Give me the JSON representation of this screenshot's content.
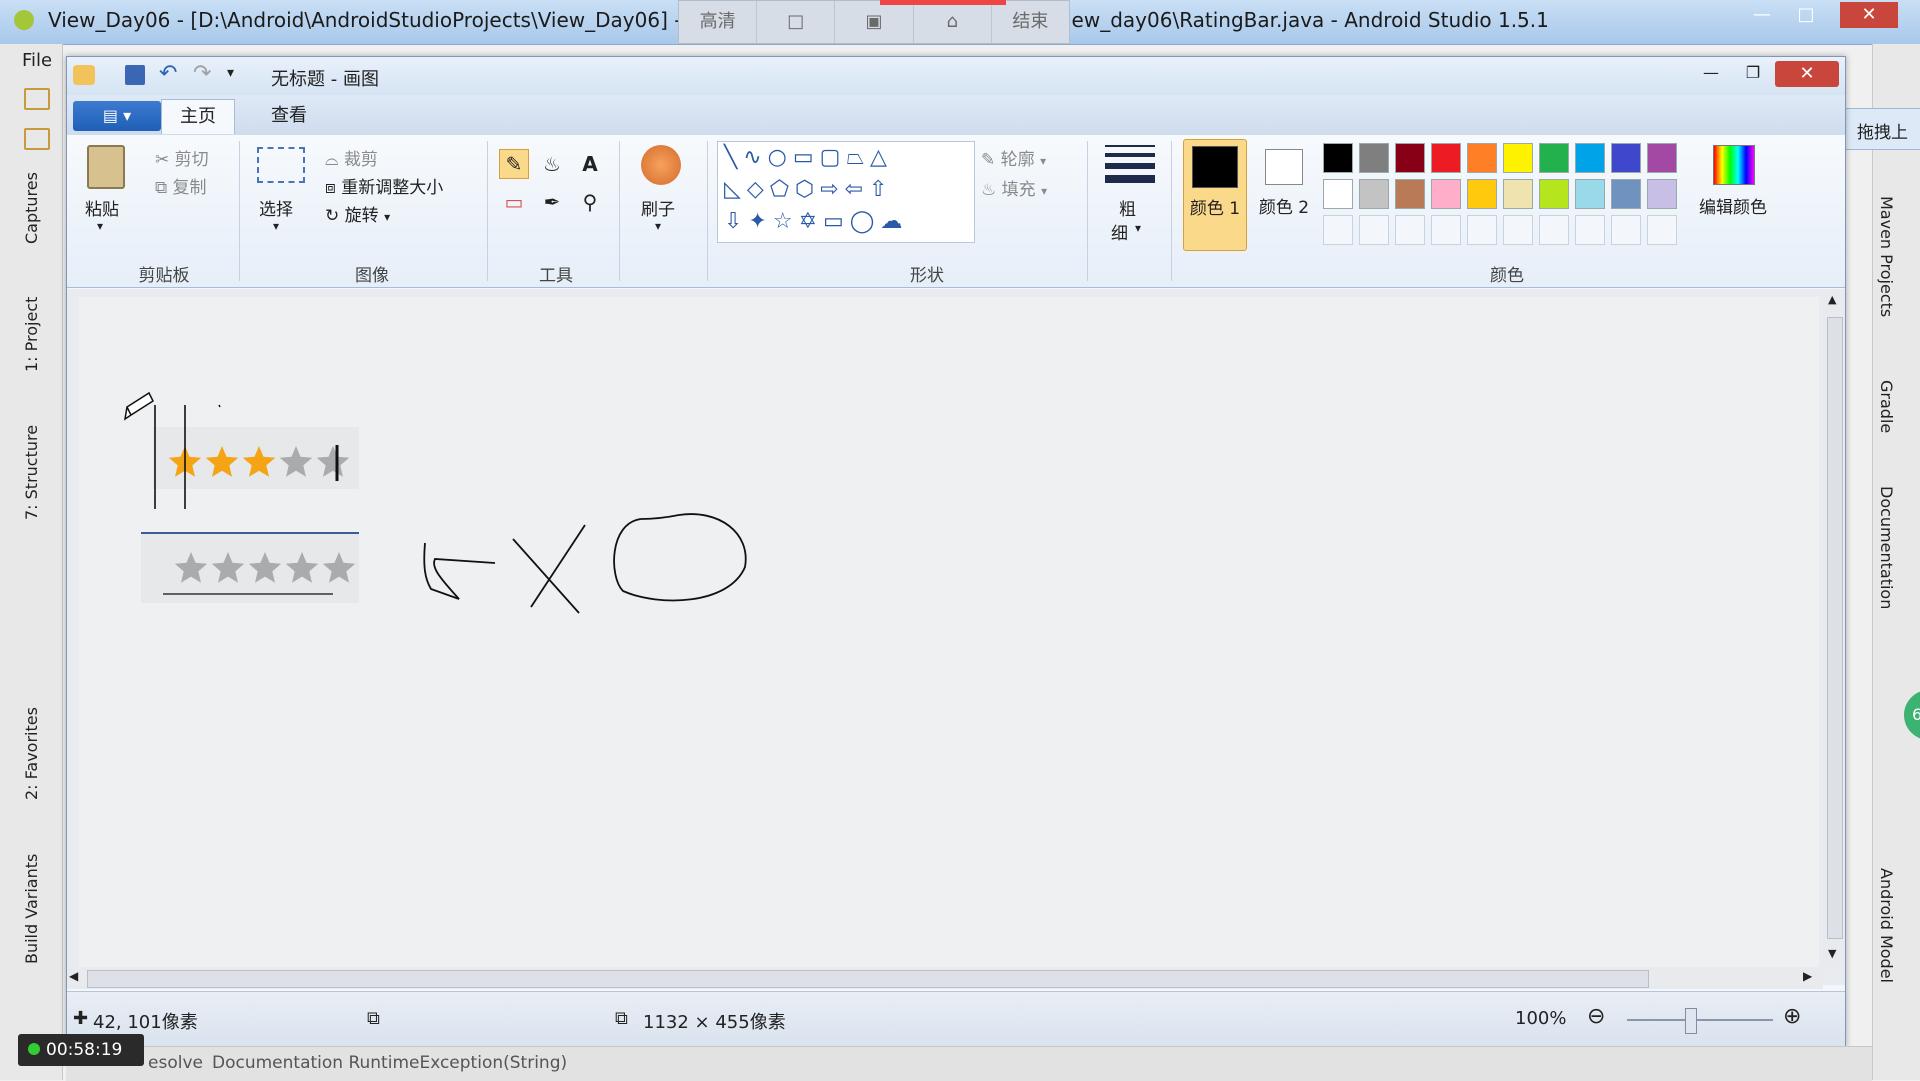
{
  "as_window": {
    "title_left": "View_Day06 - [D:\\Android\\AndroidStudioProjects\\View_Day06] - [",
    "title_right": "iew_day06\\RatingBar.java - Android Studio 1.5.1",
    "menu_file": "File",
    "left_tabs": [
      "Captures",
      "1: Project",
      "7: Structure",
      "2: Favorites",
      "Build Variants"
    ],
    "right_tabs": [
      "Maven Projects",
      "Gradle",
      "Documentation",
      "Android Model"
    ],
    "bottom_text": "Documentation RuntimeException(String)",
    "bottom_left_fragment": "esolve",
    "timer": "00:58:19",
    "badge_fragment": "6"
  },
  "recorder_toolbar": {
    "items": [
      "高清",
      "",
      "",
      "",
      "结束"
    ]
  },
  "paint": {
    "title": "无标题 - 画图",
    "tabs": [
      "主页",
      "查看"
    ],
    "clipboard": {
      "paste": "粘贴",
      "cut": "剪切",
      "copy": "复制",
      "label": "剪贴板"
    },
    "image": {
      "select": "选择",
      "crop": "裁剪",
      "resize": "重新调整大小",
      "rotate": "旋转",
      "label": "图像"
    },
    "tools": {
      "label": "工具"
    },
    "brush": {
      "label": "刷子"
    },
    "shapes": {
      "outline": "轮廓",
      "fill": "填充",
      "label": "形状"
    },
    "size": {
      "label1": "粗",
      "label2": "细"
    },
    "colors": {
      "color1": "颜色 1",
      "color2": "颜色 2",
      "edit": "编辑颜色",
      "label": "颜色",
      "palette_row1": [
        "#000000",
        "#7f7f7f",
        "#880015",
        "#ed1c24",
        "#ff7f27",
        "#fff200",
        "#22b14c",
        "#00a2e8",
        "#3f48cc",
        "#a349a4"
      ],
      "palette_row2": [
        "#ffffff",
        "#c3c3c3",
        "#b97a57",
        "#ffaec9",
        "#ffc90e",
        "#efe4b0",
        "#b5e61d",
        "#99d9ea",
        "#7092be",
        "#c8bfe7"
      ]
    },
    "status": {
      "cursor": "42, 101像素",
      "size": "1132 × 455像素",
      "zoom": "100%"
    },
    "rating_top": {
      "filled": 3,
      "total": 5
    },
    "rating_bottom": {
      "filled": 0,
      "total": 5
    }
  },
  "baidu_widget": {
    "label": "拖拽上"
  }
}
